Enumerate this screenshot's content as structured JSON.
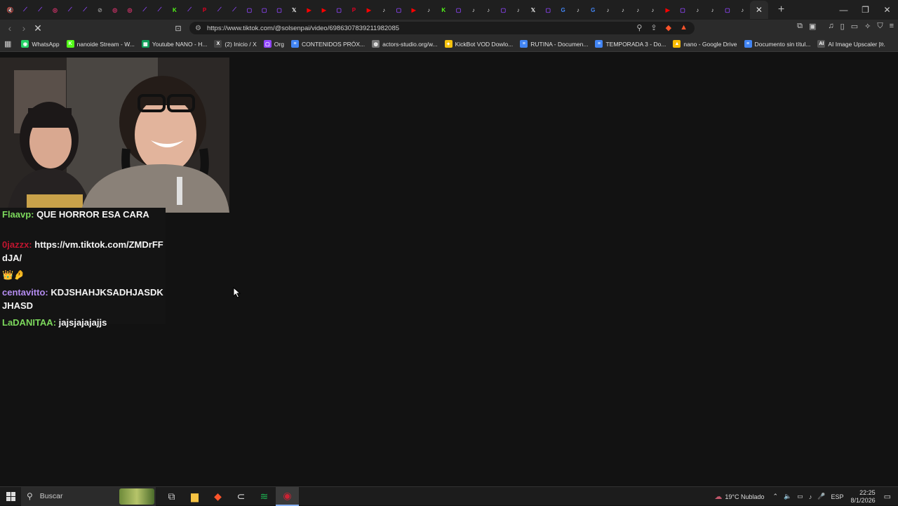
{
  "browser": {
    "tabs": [
      {
        "icon": "mute-icon",
        "color": "#cfcfcf",
        "glyph": "🔇"
      },
      {
        "icon": "twitch-icon",
        "color": "#9146ff",
        "glyph": "⟋"
      },
      {
        "icon": "twitch-icon",
        "color": "#9146ff",
        "glyph": "⟋"
      },
      {
        "icon": "target-icon",
        "color": "#d6336c",
        "glyph": "◎"
      },
      {
        "icon": "twitch-icon",
        "color": "#9146ff",
        "glyph": "⟋"
      },
      {
        "icon": "twitch-icon",
        "color": "#9146ff",
        "glyph": "⟋"
      },
      {
        "icon": "disabled-icon",
        "color": "#888888",
        "glyph": "⊘"
      },
      {
        "icon": "target-icon",
        "color": "#d6336c",
        "glyph": "◎"
      },
      {
        "icon": "target-icon",
        "color": "#d6336c",
        "glyph": "◎"
      },
      {
        "icon": "twitch-icon",
        "color": "#9146ff",
        "glyph": "⟋"
      },
      {
        "icon": "twitch-icon",
        "color": "#9146ff",
        "glyph": "⟋"
      },
      {
        "icon": "kick-icon",
        "color": "#53fc18",
        "glyph": "K"
      },
      {
        "icon": "twitch-icon",
        "color": "#9146ff",
        "glyph": "⟋"
      },
      {
        "icon": "pinterest-icon",
        "color": "#e60023",
        "glyph": "P"
      },
      {
        "icon": "twitch-icon",
        "color": "#9146ff",
        "glyph": "⟋"
      },
      {
        "icon": "twitch-icon",
        "color": "#9146ff",
        "glyph": "⟋"
      },
      {
        "icon": "twitch-icon",
        "color": "#9146ff",
        "glyph": "▢"
      },
      {
        "icon": "twitch-icon",
        "color": "#9146ff",
        "glyph": "▢"
      },
      {
        "icon": "twitch-icon",
        "color": "#9146ff",
        "glyph": "▢"
      },
      {
        "icon": "x-icon",
        "color": "#e0e0e0",
        "glyph": "𝕏"
      },
      {
        "icon": "youtube-icon",
        "color": "#ff0000",
        "glyph": "▶"
      },
      {
        "icon": "youtube-icon",
        "color": "#ff0000",
        "glyph": "▶"
      },
      {
        "icon": "twitch-icon",
        "color": "#9146ff",
        "glyph": "▢"
      },
      {
        "icon": "pinterest-icon",
        "color": "#e60023",
        "glyph": "P"
      },
      {
        "icon": "youtube-icon",
        "color": "#ff0000",
        "glyph": "▶"
      },
      {
        "icon": "tiktok-icon",
        "color": "#e0e0e0",
        "glyph": "♪"
      },
      {
        "icon": "twitch-icon",
        "color": "#9146ff",
        "glyph": "▢"
      },
      {
        "icon": "youtube-icon",
        "color": "#ff0000",
        "glyph": "▶"
      },
      {
        "icon": "tiktok-icon",
        "color": "#e0e0e0",
        "glyph": "♪"
      },
      {
        "icon": "kick-icon",
        "color": "#53fc18",
        "glyph": "K"
      },
      {
        "icon": "twitch-icon",
        "color": "#9146ff",
        "glyph": "▢"
      },
      {
        "icon": "tiktok-icon",
        "color": "#e0e0e0",
        "glyph": "♪"
      },
      {
        "icon": "tiktok-icon",
        "color": "#e0e0e0",
        "glyph": "♪"
      },
      {
        "icon": "twitch-icon",
        "color": "#9146ff",
        "glyph": "▢"
      },
      {
        "icon": "tiktok-icon",
        "color": "#e0e0e0",
        "glyph": "♪"
      },
      {
        "icon": "x-icon",
        "color": "#e0e0e0",
        "glyph": "𝕏"
      },
      {
        "icon": "twitch-icon",
        "color": "#9146ff",
        "glyph": "▢"
      },
      {
        "icon": "google-icon",
        "color": "#4285f4",
        "glyph": "G"
      },
      {
        "icon": "tiktok-icon",
        "color": "#e0e0e0",
        "glyph": "♪"
      },
      {
        "icon": "google-icon",
        "color": "#4285f4",
        "glyph": "G"
      },
      {
        "icon": "tiktok-icon",
        "color": "#e0e0e0",
        "glyph": "♪"
      },
      {
        "icon": "tiktok-icon",
        "color": "#e0e0e0",
        "glyph": "♪"
      },
      {
        "icon": "tiktok-icon",
        "color": "#e0e0e0",
        "glyph": "♪"
      },
      {
        "icon": "tiktok-icon",
        "color": "#e0e0e0",
        "glyph": "♪"
      },
      {
        "icon": "youtube-icon",
        "color": "#ff0000",
        "glyph": "▶"
      },
      {
        "icon": "twitch-icon",
        "color": "#9146ff",
        "glyph": "▢"
      },
      {
        "icon": "tiktok-icon",
        "color": "#e0e0e0",
        "glyph": "♪"
      },
      {
        "icon": "tiktok-icon",
        "color": "#e0e0e0",
        "glyph": "♪"
      },
      {
        "icon": "twitch-icon",
        "color": "#9146ff",
        "glyph": "▢"
      },
      {
        "icon": "tiktok-icon",
        "color": "#e0e0e0",
        "glyph": "♪"
      }
    ],
    "url": "https://www.tiktok.com/@solsenpai/video/6986307839211982085",
    "bookmarks": [
      {
        "label": "WhatsApp",
        "icon": "whatsapp-icon",
        "color": "#25d366",
        "glyph": "◉"
      },
      {
        "label": "nanoide Stream - W...",
        "icon": "kick-icon",
        "color": "#53fc18",
        "glyph": "K"
      },
      {
        "label": "Youtube NANO - H...",
        "icon": "sheets-icon",
        "color": "#0f9d58",
        "glyph": "▦"
      },
      {
        "label": "(2) Inicio / X",
        "icon": "x-icon",
        "color": "#444444",
        "glyph": "X"
      },
      {
        "label": "Org",
        "icon": "twitch-icon",
        "color": "#9146ff",
        "glyph": "▢"
      },
      {
        "label": "CONTENIDOS PRÓX...",
        "icon": "docs-icon",
        "color": "#4285f4",
        "glyph": "≡"
      },
      {
        "label": "actors-studio.org/w...",
        "icon": "globe-icon",
        "color": "#777777",
        "glyph": "◍"
      },
      {
        "label": "KickBot VOD Dowlo...",
        "icon": "bot-icon",
        "color": "#f4c20d",
        "glyph": "✦"
      },
      {
        "label": "RUTINA - Documen...",
        "icon": "docs-icon",
        "color": "#4285f4",
        "glyph": "≡"
      },
      {
        "label": "TEMPORADA 3 - Do...",
        "icon": "docs-icon",
        "color": "#4285f4",
        "glyph": "≡"
      },
      {
        "label": "nano - Google Drive",
        "icon": "drive-icon",
        "color": "#fbbc04",
        "glyph": "▲"
      },
      {
        "label": "Documento sin títul...",
        "icon": "docs-icon",
        "color": "#4285f4",
        "glyph": "≡"
      },
      {
        "label": "AI Image Upscaler |...",
        "icon": "ai-icon",
        "color": "#555555",
        "glyph": "AI"
      }
    ]
  },
  "chat": {
    "messages": [
      {
        "user": "Flaavp:",
        "user_color": "#7cd85c",
        "text": "QUE HORROR ESA CARA"
      },
      {
        "user": "0jazzx:",
        "user_color": "#c0152f",
        "text": "https://vm.tiktok.com/ZMDrFFdJA/"
      },
      {
        "user": "",
        "user_color": "#ffffff",
        "text": "👑🤌"
      },
      {
        "user": "centavitto:",
        "user_color": "#b48cf0",
        "text": "KDJSHAHJKSADHJASDKJHASD"
      },
      {
        "user": "LaDANITAA:",
        "user_color": "#7cd85c",
        "text": "jajsjajajajjs"
      }
    ]
  },
  "taskbar": {
    "search_placeholder": "Buscar",
    "apps": [
      {
        "icon": "task-view-icon",
        "color": "#cccccc",
        "glyph": "⧉"
      },
      {
        "icon": "file-explorer-icon",
        "color": "#f6c343",
        "glyph": "▆"
      },
      {
        "icon": "brave-icon",
        "color": "#fb542b",
        "glyph": "◆"
      },
      {
        "icon": "capcut-icon",
        "color": "#e0e0e0",
        "glyph": "⊂"
      },
      {
        "icon": "spotify-icon",
        "color": "#1db954",
        "glyph": "≋"
      },
      {
        "icon": "obs-icon",
        "color": "#cc2233",
        "glyph": "◉"
      }
    ],
    "weather": "19°C  Nublado",
    "language": "ESP",
    "time": "22:25",
    "date": "8/1/2026"
  }
}
